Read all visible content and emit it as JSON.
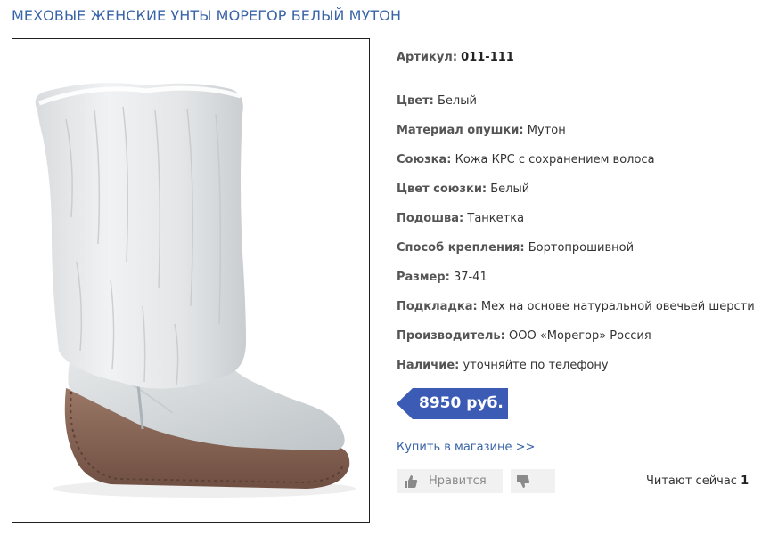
{
  "product": {
    "title": "МЕХОВЫЕ ЖЕНСКИЕ УНТЫ МОРЕГОР БЕЛЫЙ МУТОН",
    "article": {
      "label": "Артикул:",
      "value": "011-111"
    },
    "specs": [
      {
        "label": "Цвет:",
        "value": "Белый"
      },
      {
        "label": "Материал опушки:",
        "value": "Мутон"
      },
      {
        "label": "Союзка:",
        "value": "Кожа КРС с сохранением волоса"
      },
      {
        "label": "Цвет союзки:",
        "value": "Белый"
      },
      {
        "label": "Подошва:",
        "value": "Танкетка"
      },
      {
        "label": "Способ крепления:",
        "value": "Бортопрошивной"
      },
      {
        "label": "Размер:",
        "value": "37-41"
      },
      {
        "label": "Подкладка:",
        "value": "Мех на основе натуральной овечьей шерсти"
      },
      {
        "label": "Производитель:",
        "value": "ООО «Морегор» Россия"
      },
      {
        "label": "Наличие:",
        "value": "уточняйте по телефону"
      }
    ],
    "price": "8950 руб.",
    "price_color": "#3b5bb5",
    "buy_link": "Купить в магазине >>",
    "like_label": "Нравится",
    "reading_label": "Читают сейчас",
    "reading_count": "1"
  },
  "icons": {
    "like": "thumbs-up-icon",
    "dislike": "thumbs-down-icon"
  },
  "colors": {
    "title": "#3a64a8",
    "link": "#3a64a8",
    "button_bg": "#f1f1f1",
    "sole": "#8a6553"
  }
}
